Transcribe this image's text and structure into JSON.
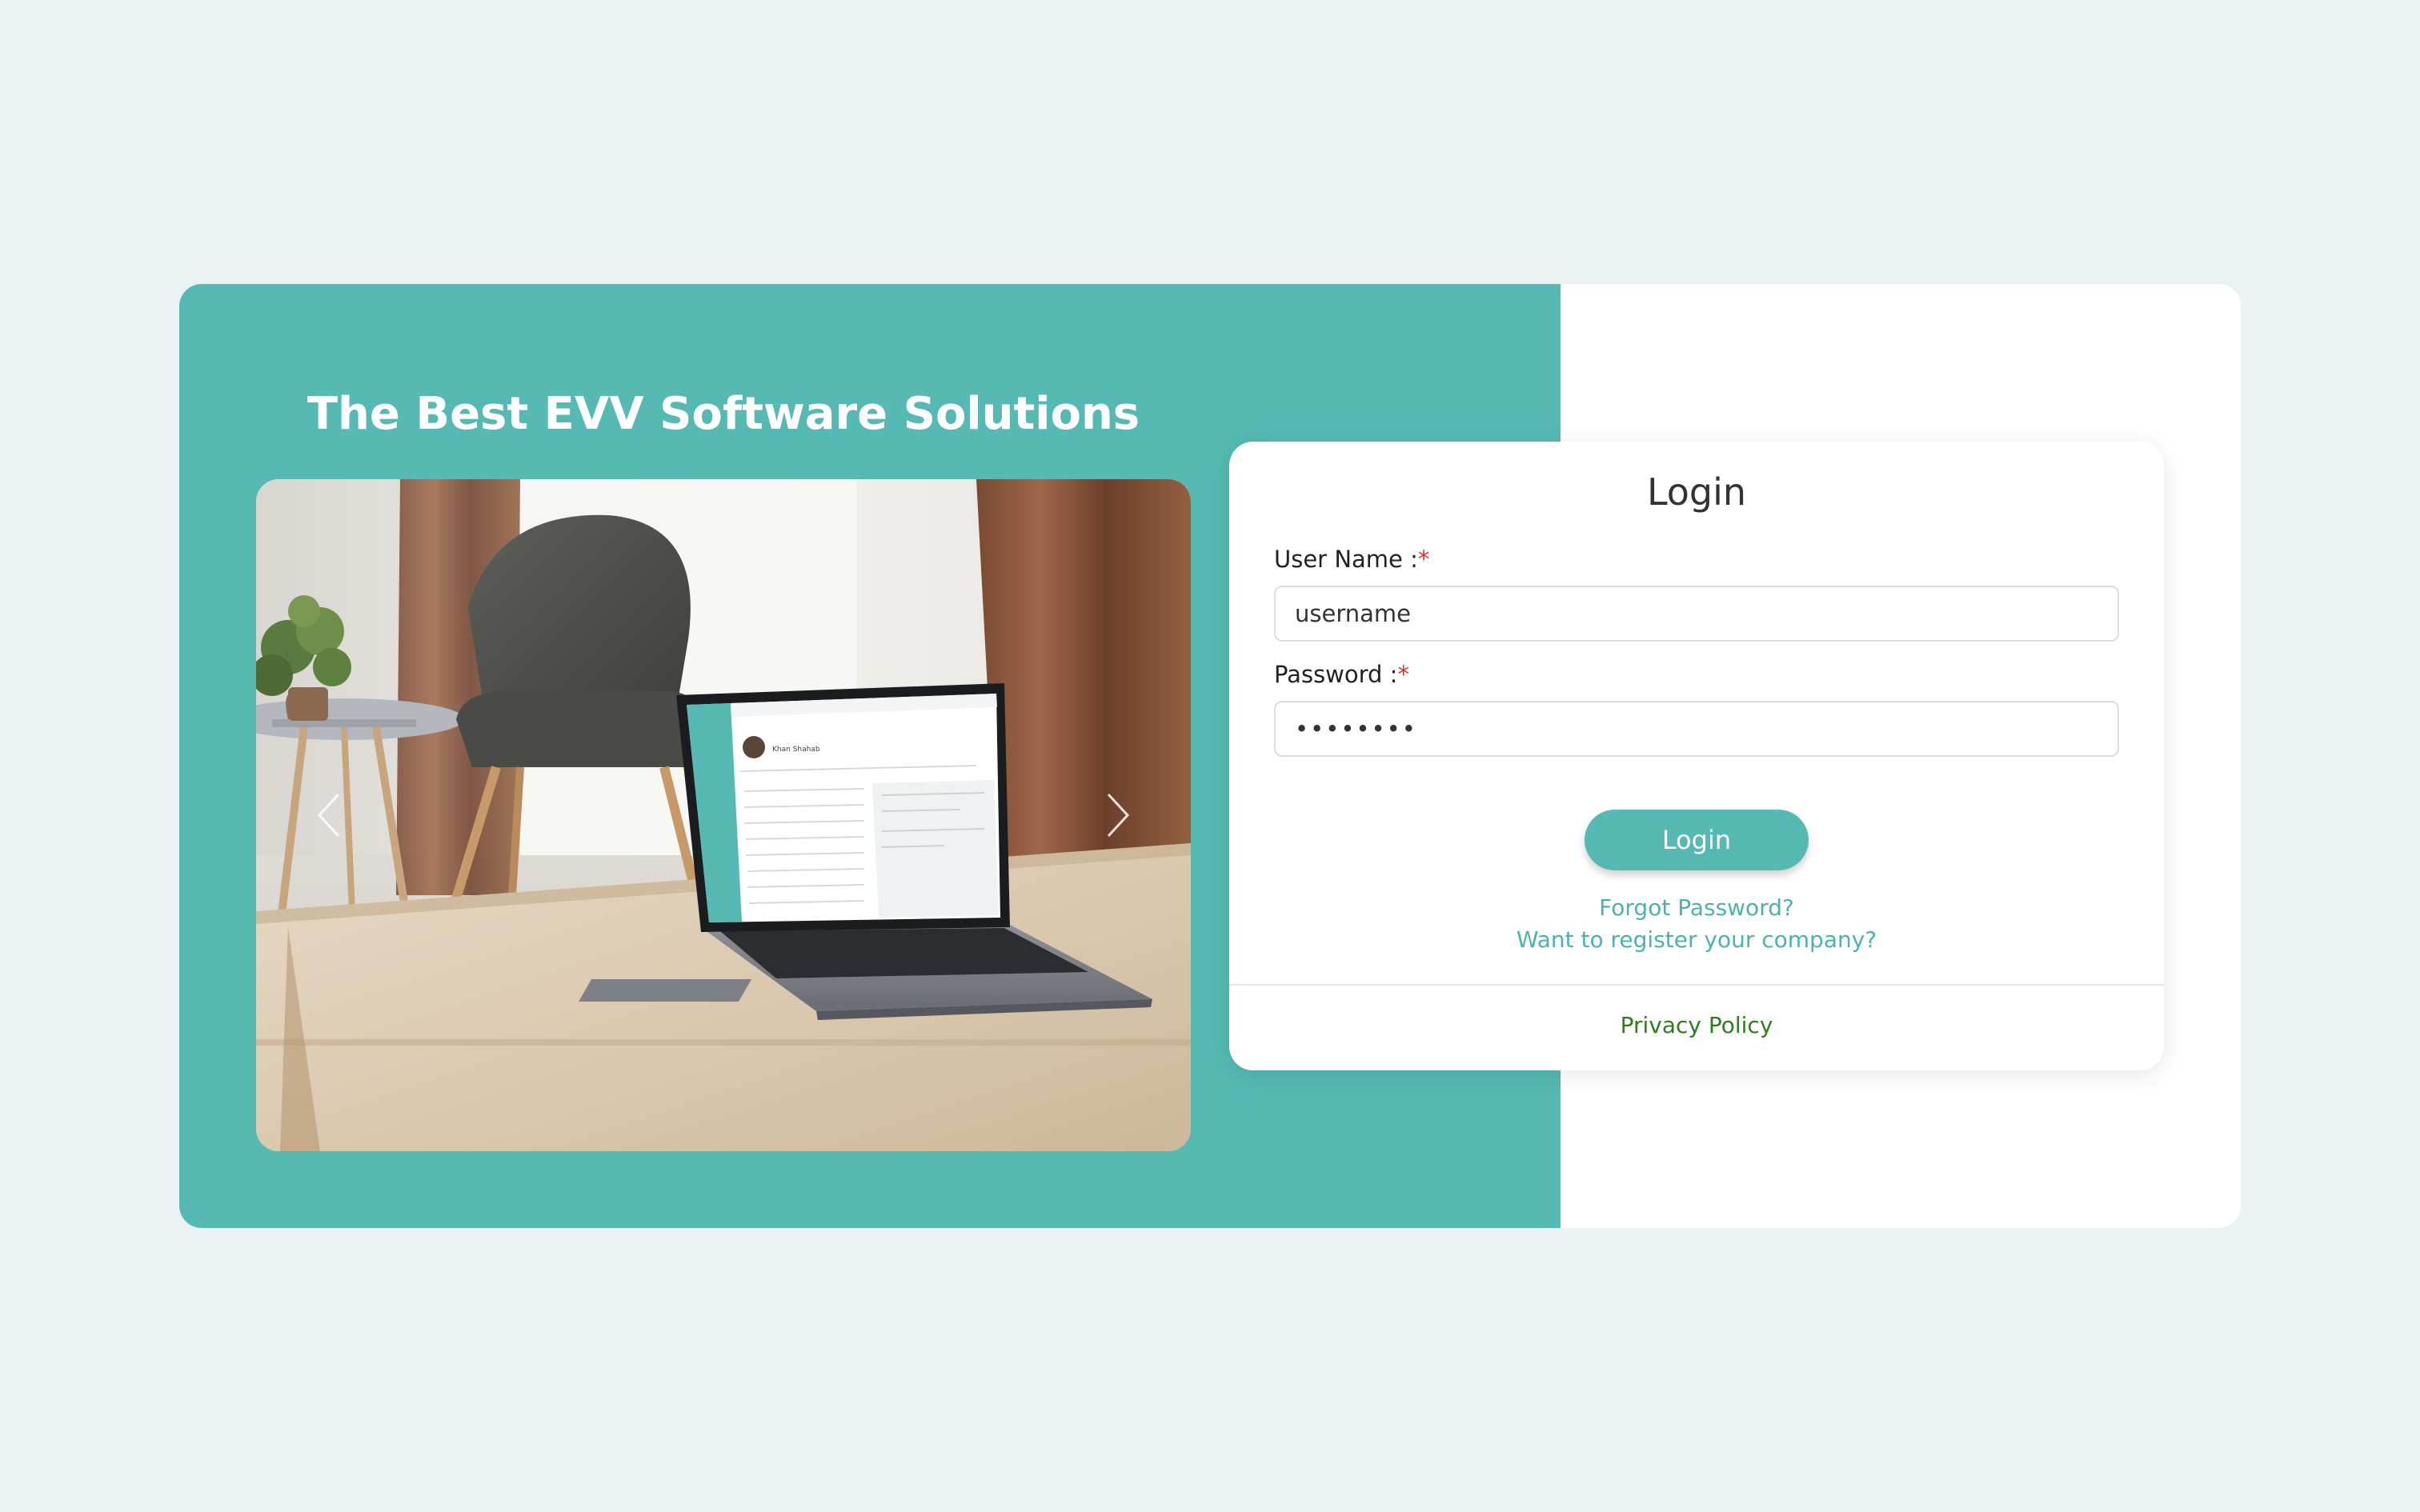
{
  "hero": {
    "headline": "The Best EVV Software Solutions",
    "laptop_screen_name": "Khan Shahab",
    "carousel_prev_icon": "chevron-left-icon",
    "carousel_next_icon": "chevron-right-icon"
  },
  "login": {
    "title": "Login",
    "username_label": "User Name :",
    "password_label": "Password :",
    "required_marker": "*",
    "username_value": "username",
    "password_value": "••••••••",
    "button_label": "Login",
    "forgot_password": "Forgot Password?",
    "register_company": "Want to register your company?",
    "privacy_policy": "Privacy Policy"
  },
  "colors": {
    "page_background": "#eaf1f3",
    "brand_teal": "#56b9b4",
    "link_teal": "#4bb3ad",
    "privacy_green": "#2e7d1f",
    "required_red": "#d9342b"
  }
}
